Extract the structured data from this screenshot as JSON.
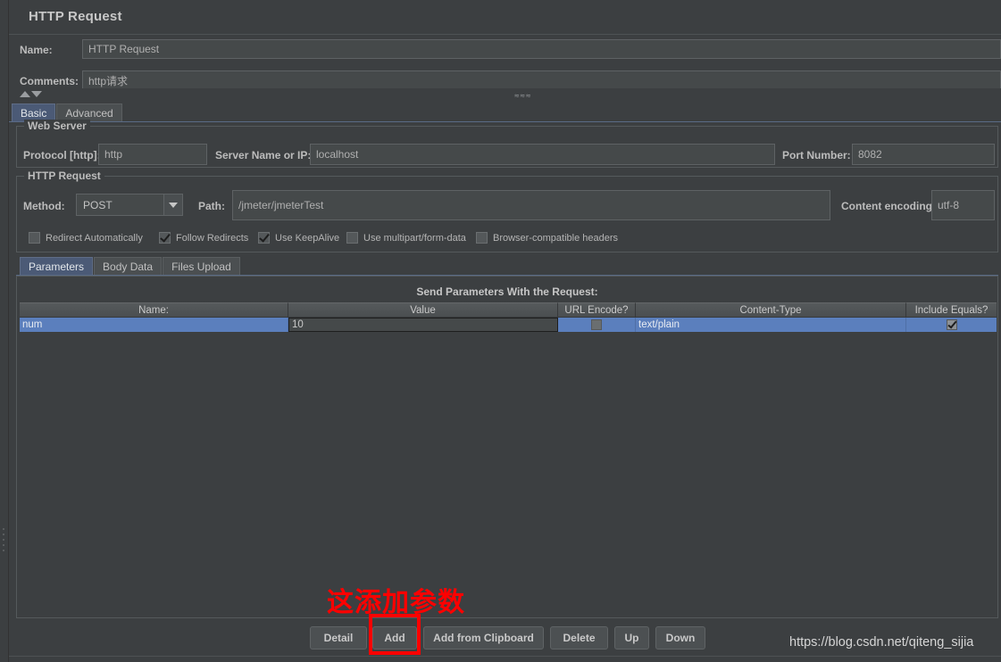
{
  "window": {
    "title": "HTTP Request"
  },
  "form": {
    "name_label": "Name:",
    "name_value": "HTTP Request",
    "comments_label": "Comments:",
    "comments_value": "http请求"
  },
  "main_tabs": [
    {
      "label": "Basic",
      "active": true
    },
    {
      "label": "Advanced",
      "active": false
    }
  ],
  "web_server": {
    "group_title": "Web Server",
    "protocol_label": "Protocol [http]:",
    "protocol_value": "http",
    "server_label": "Server Name or IP:",
    "server_value": "localhost",
    "port_label": "Port Number:",
    "port_value": "8082"
  },
  "http_request": {
    "group_title": "HTTP Request",
    "method_label": "Method:",
    "method_value": "POST",
    "path_label": "Path:",
    "path_value": "/jmeter/jmeterTest",
    "encoding_label": "Content encoding:",
    "encoding_value": "utf-8",
    "options": [
      {
        "label": "Redirect Automatically",
        "checked": false
      },
      {
        "label": "Follow Redirects",
        "checked": true
      },
      {
        "label": "Use KeepAlive",
        "checked": true
      },
      {
        "label": "Use multipart/form-data",
        "checked": false
      },
      {
        "label": "Browser-compatible headers",
        "checked": false
      }
    ]
  },
  "param_tabs": [
    {
      "label": "Parameters",
      "active": true
    },
    {
      "label": "Body Data",
      "active": false
    },
    {
      "label": "Files Upload",
      "active": false
    }
  ],
  "table": {
    "caption": "Send Parameters With the Request:",
    "columns": [
      "Name:",
      "Value",
      "URL Encode?",
      "Content-Type",
      "Include Equals?"
    ],
    "rows": [
      {
        "name": "num",
        "value": "10",
        "url_encode": false,
        "content_type": "text/plain",
        "include_equals": true,
        "selected": true,
        "value_editing": true
      }
    ]
  },
  "buttons": [
    {
      "label": "Detail"
    },
    {
      "label": "Add"
    },
    {
      "label": "Add from Clipboard"
    },
    {
      "label": "Delete"
    },
    {
      "label": "Up"
    },
    {
      "label": "Down"
    }
  ],
  "annotation": {
    "text": "这添加参数",
    "color": "#ff0000",
    "target": "Add"
  },
  "watermark": {
    "text": "https://blog.csdn.net/qiteng_sijia"
  },
  "colors": {
    "background": "#3c3f41",
    "field_background": "#45494a",
    "selection_blue": "#5b7fbd",
    "tab_active_blue": "#4b5a76",
    "text": "#bcbcbc",
    "annotation_red": "#ff0000"
  }
}
